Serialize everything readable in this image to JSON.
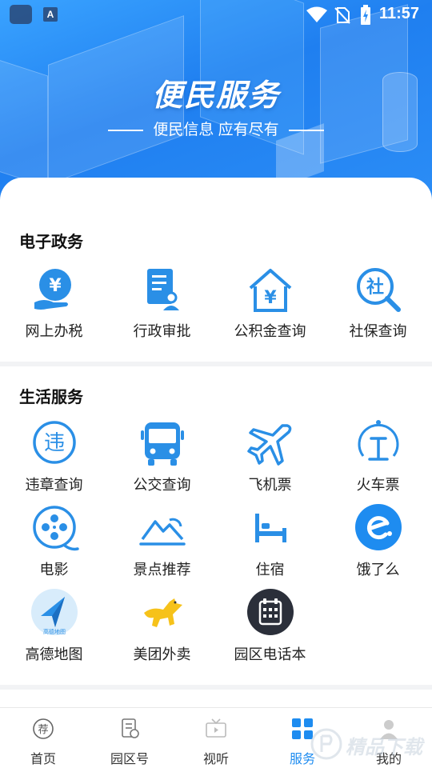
{
  "status_bar": {
    "time": "11:57",
    "app_icon_letter": "A"
  },
  "header": {
    "title": "便民服务",
    "subtitle": "便民信息 应有尽有"
  },
  "gov_section": {
    "title": "电子政务",
    "items": [
      {
        "label": "网上办税",
        "icon": "tax-coin-icon"
      },
      {
        "label": "行政审批",
        "icon": "document-approval-icon"
      },
      {
        "label": "公积金查询",
        "icon": "house-fund-icon"
      },
      {
        "label": "社保查询",
        "icon": "social-security-search-icon"
      }
    ]
  },
  "life_section": {
    "title": "生活服务",
    "items": [
      {
        "label": "违章查询",
        "icon": "violation-icon",
        "glyph": "违"
      },
      {
        "label": "公交查询",
        "icon": "bus-icon"
      },
      {
        "label": "飞机票",
        "icon": "airplane-icon"
      },
      {
        "label": "火车票",
        "icon": "train-icon"
      },
      {
        "label": "电影",
        "icon": "film-reel-icon"
      },
      {
        "label": "景点推荐",
        "icon": "mountain-icon"
      },
      {
        "label": "住宿",
        "icon": "bed-icon"
      },
      {
        "label": "饿了么",
        "icon": "eleme-logo-icon"
      },
      {
        "label": "高德地图",
        "icon": "amap-logo-icon",
        "logo_text": "高德地图"
      },
      {
        "label": "美团外卖",
        "icon": "meituan-kangaroo-icon"
      },
      {
        "label": "园区电话本",
        "icon": "phonebook-icon"
      }
    ]
  },
  "gov_glyph": "社",
  "bottom_nav": {
    "tabs": [
      {
        "label": "首页",
        "icon": "home-recommend-icon",
        "glyph": "荐"
      },
      {
        "label": "园区号",
        "icon": "park-account-icon"
      },
      {
        "label": "视听",
        "icon": "tv-icon"
      },
      {
        "label": "服务",
        "icon": "service-grid-icon",
        "active": true
      },
      {
        "label": "我的",
        "icon": "profile-icon"
      }
    ]
  },
  "watermark_text": "精品下载",
  "colors": {
    "accent": "#1e8cf0",
    "icon_blue": "#2a8fe6",
    "banner_blue": "#2b8df6"
  }
}
